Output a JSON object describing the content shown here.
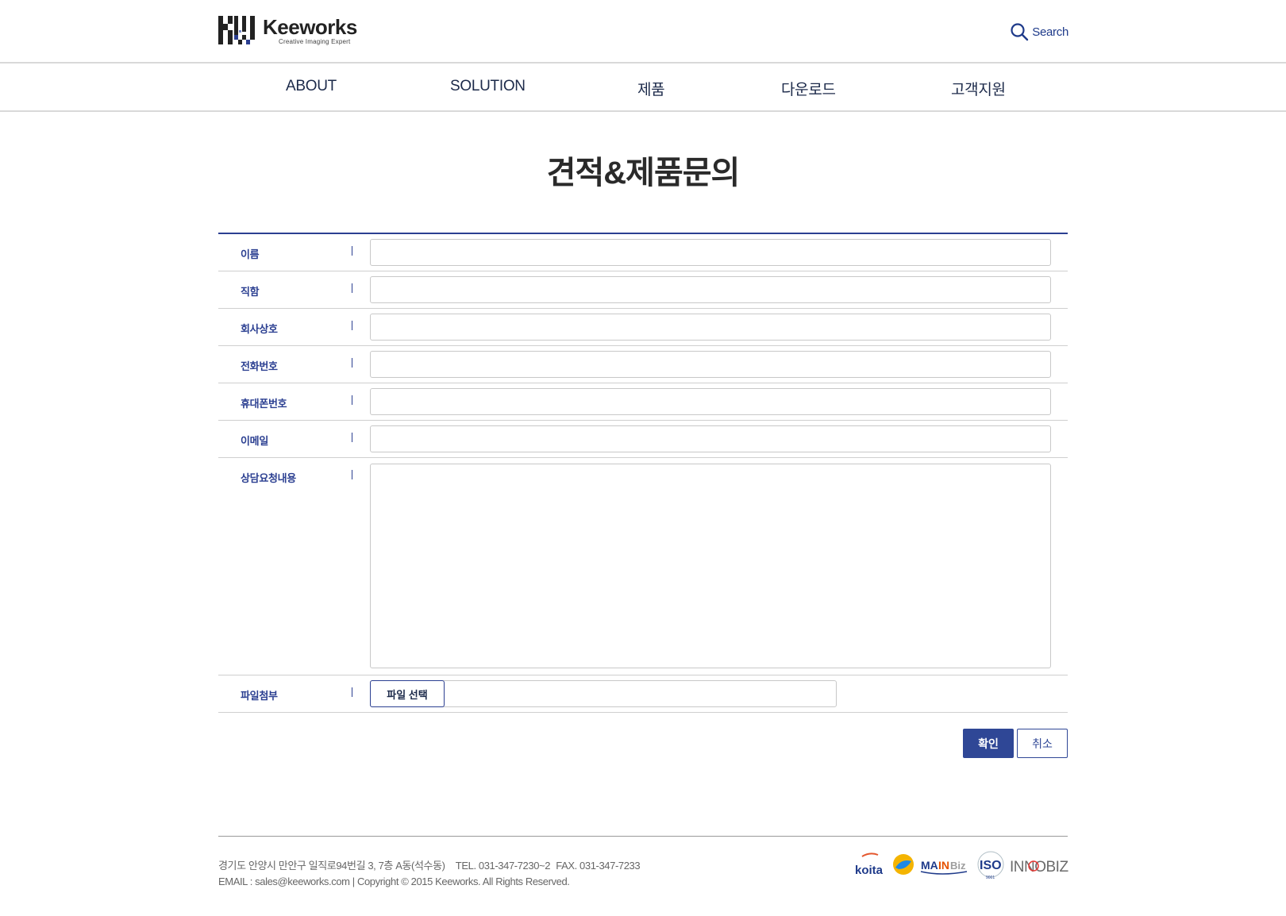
{
  "header": {
    "logo_name": "Keeworks",
    "logo_tagline": "Creative Imaging Expert",
    "search_label": "Search"
  },
  "nav": {
    "items": [
      "ABOUT",
      "SOLUTION",
      "제품",
      "다운로드",
      "고객지원"
    ]
  },
  "page": {
    "title": "견적&제품문의"
  },
  "form": {
    "fields": [
      {
        "label": "이름",
        "value": ""
      },
      {
        "label": "직함",
        "value": ""
      },
      {
        "label": "회사상호",
        "value": ""
      },
      {
        "label": "전화번호",
        "value": ""
      },
      {
        "label": "휴대폰번호",
        "value": ""
      },
      {
        "label": "이메일",
        "value": ""
      }
    ],
    "message_label": "상담요청내용",
    "message_value": "",
    "file_label": "파일첨부",
    "file_button": "파일 선택",
    "file_value": ""
  },
  "actions": {
    "confirm": "확인",
    "cancel": "취소"
  },
  "footer": {
    "address": "경기도 안양시 만안구 일직로94번길 3, 7층 A동(석수동)",
    "tel": "TEL. 031-347-7230~2",
    "fax": "FAX. 031-347-7233",
    "email_copyright": "EMAIL : sales@keeworks.com | Copyright © 2015 Keeworks. All Rights Reserved.",
    "cert_logos": [
      "koita",
      "venture",
      "MAINBiz",
      "ISO 9001",
      "INNOBIZ"
    ]
  },
  "colors": {
    "brand_navy": "#2b3f91",
    "nav_text": "#1c2a4a",
    "border": "#cfcfcf"
  }
}
